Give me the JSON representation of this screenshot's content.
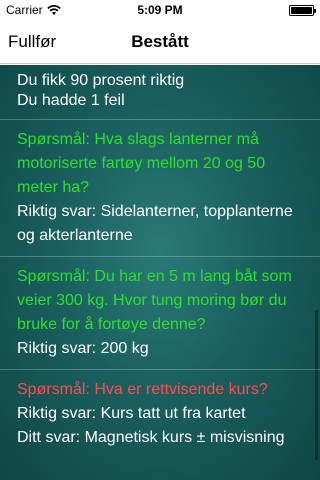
{
  "status": {
    "carrier": "Carrier",
    "time": "5:09 PM"
  },
  "nav": {
    "left_button": "Fullfør",
    "title": "Bestått"
  },
  "summary": {
    "line1": "Du fikk 90 prosent riktig",
    "line2": "Du hadde 1 feil"
  },
  "results": [
    {
      "question": "Spørsmål: Hva slags lanterner må motoriserte fartøy mellom 20 og 50 meter ha?",
      "correct_answer": "Riktig svar: Sidelanterner, topplanterne og akterlanterne",
      "status": "correct"
    },
    {
      "question": "Spørsmål: Du har en 5 m lang båt som veier 300 kg. Hvor tung moring bør du bruke for å fortøye denne?",
      "correct_answer": "Riktig svar: 200 kg",
      "status": "correct"
    },
    {
      "question": "Spørsmål: Hva er rettvisende kurs?",
      "correct_answer": "Riktig svar: Kurs tatt ut fra kartet",
      "your_answer": "Ditt svar: Magnetisk kurs ± misvisning",
      "status": "wrong"
    }
  ],
  "colors": {
    "correct": "#2de02d",
    "wrong": "#ff4d4d",
    "background": "#1a5f5e"
  }
}
